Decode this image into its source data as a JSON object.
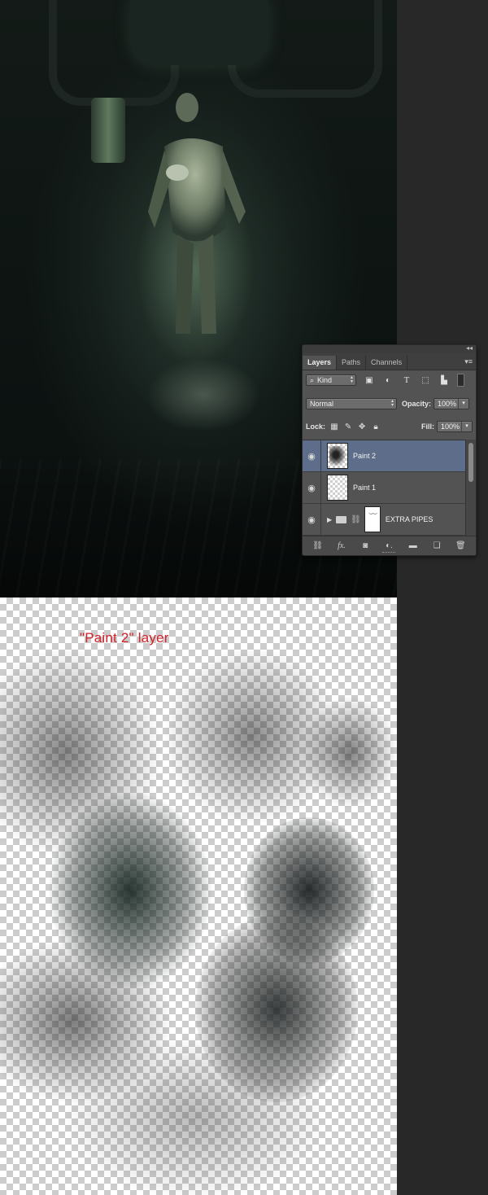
{
  "preview": {
    "label": "\"Paint 2\" layer"
  },
  "layers_panel": {
    "tabs": [
      {
        "label": "Layers",
        "active": true
      },
      {
        "label": "Paths",
        "active": false
      },
      {
        "label": "Channels",
        "active": false
      }
    ],
    "filter": {
      "kind_label": "Kind"
    },
    "blend_mode": "Normal",
    "opacity_label": "Opacity:",
    "opacity_value": "100%",
    "lock_label": "Lock:",
    "fill_label": "Fill:",
    "fill_value": "100%",
    "layers": [
      {
        "name": "Paint 2",
        "selected": true
      },
      {
        "name": "Paint 1",
        "selected": false
      },
      {
        "name": "EXTRA PIPES",
        "selected": false,
        "type": "group"
      }
    ]
  },
  "colors": {
    "panel_bg": "#535353",
    "selected_layer": "#5d6d8a",
    "label_red": "#d2232a",
    "page_bg": "#282828"
  },
  "icons": [
    "eye-icon",
    "folder-icon",
    "link-icon",
    "fx-icon",
    "mask-icon",
    "adjustment-icon",
    "new-group-icon",
    "new-layer-icon",
    "trash-icon",
    "search-icon",
    "lock-icon",
    "move-icon",
    "brush-icon"
  ]
}
